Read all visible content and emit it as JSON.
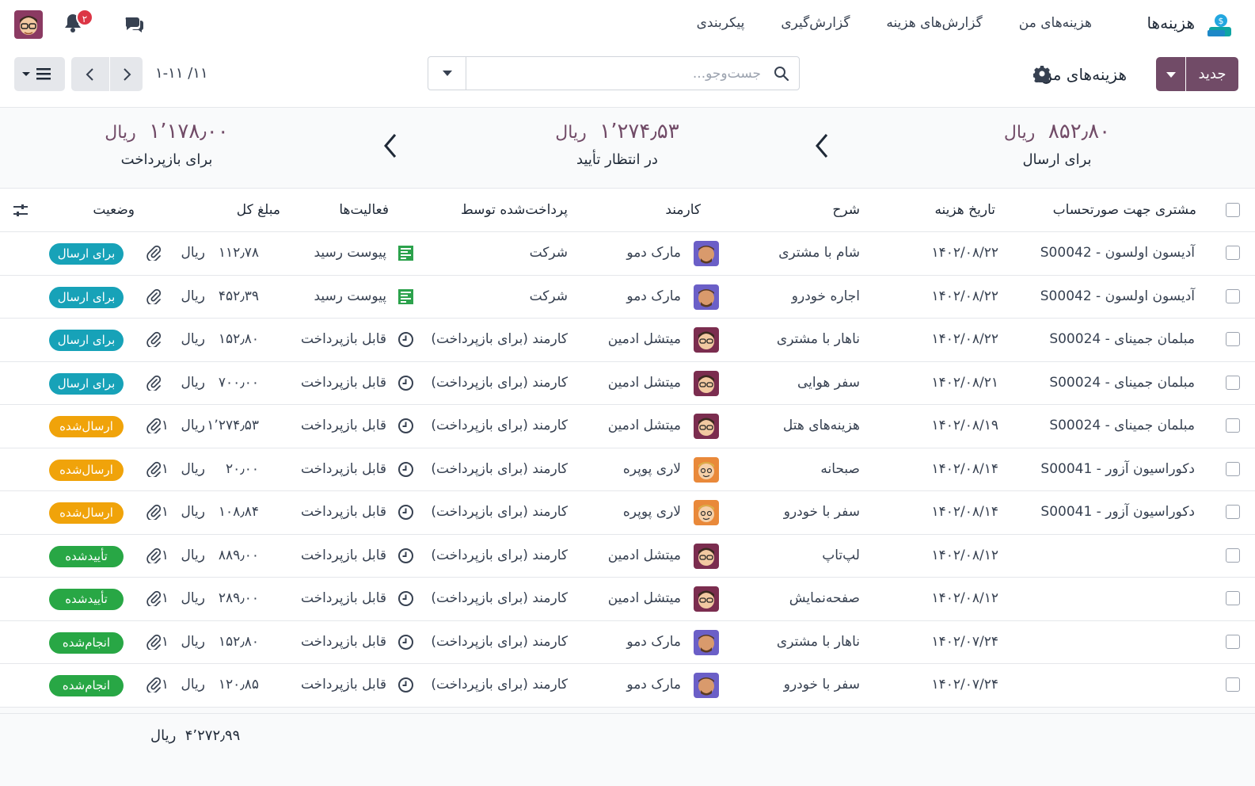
{
  "navbar": {
    "app_name": "هزینه‌ها",
    "menu": [
      "هزینه‌های من",
      "گزارش‌های هزینه",
      "گزارش‌گیری",
      "پیکربندی"
    ],
    "notification_count": "۲"
  },
  "control_panel": {
    "new_button": "جدید",
    "breadcrumb": "هزینه‌های من",
    "search_placeholder": "جست‌وجو...",
    "pager": "۱-۱۱ /۱۱"
  },
  "summary": {
    "currency": "ریال",
    "to_submit": {
      "amount": "۸۵۲٫۸۰",
      "label": "برای ارسال"
    },
    "pending": {
      "amount": "۱٬۲۷۴٫۵۳",
      "label": "در انتظار تأیید"
    },
    "to_reimburse": {
      "amount": "۱٬۱۷۸٫۰۰",
      "label": "برای بازپرداخت"
    }
  },
  "table": {
    "headers": {
      "customer": "مشتری جهت صورتحساب",
      "date": "تاریخ هزینه",
      "description": "شرح",
      "employee": "کارمند",
      "paid_by": "پرداخت‌شده توسط",
      "activities": "فعالیت‌ها",
      "total": "مبلغ کل",
      "status": "وضعیت"
    },
    "currency": "ریال",
    "rows": [
      {
        "customer": "آدیسون اولسون - S00042",
        "date": "۱۴۰۲/۰۸/۲۲",
        "description": "شام با مشتری",
        "employee": "مارک دمو",
        "avatar": "marc",
        "paid_by": "شرکت",
        "activity": "پیوست رسید",
        "activity_icon": "receipt-icon",
        "amount": "۱۱۲٫۷۸",
        "attachments": "",
        "status": "برای ارسال",
        "status_color": "#17a2b8"
      },
      {
        "customer": "آدیسون اولسون - S00042",
        "date": "۱۴۰۲/۰۸/۲۲",
        "description": "اجاره خودرو",
        "employee": "مارک دمو",
        "avatar": "marc",
        "paid_by": "شرکت",
        "activity": "پیوست رسید",
        "activity_icon": "receipt-icon",
        "amount": "۴۵۲٫۳۹",
        "attachments": "",
        "status": "برای ارسال",
        "status_color": "#17a2b8"
      },
      {
        "customer": "مبلمان جمینای - S00024",
        "date": "۱۴۰۲/۰۸/۲۲",
        "description": "ناهار با مشتری",
        "employee": "میتشل ادمین",
        "avatar": "mitchell",
        "paid_by": "کارمند (برای بازپرداخت)",
        "activity": "قابل بازپرداخت",
        "activity_icon": "clock-icon",
        "amount": "۱۵۲٫۸۰",
        "attachments": "",
        "status": "برای ارسال",
        "status_color": "#17a2b8"
      },
      {
        "customer": "مبلمان جمینای - S00024",
        "date": "۱۴۰۲/۰۸/۲۱",
        "description": "سفر هوایی",
        "employee": "میتشل ادمین",
        "avatar": "mitchell",
        "paid_by": "کارمند (برای بازپرداخت)",
        "activity": "قابل بازپرداخت",
        "activity_icon": "clock-icon",
        "amount": "۷۰۰٫۰۰",
        "attachments": "",
        "status": "برای ارسال",
        "status_color": "#17a2b8"
      },
      {
        "customer": "مبلمان جمینای - S00024",
        "date": "۱۴۰۲/۰۸/۱۹",
        "description": "هزینه‌های هتل",
        "employee": "میتشل ادمین",
        "avatar": "mitchell",
        "paid_by": "کارمند (برای بازپرداخت)",
        "activity": "قابل بازپرداخت",
        "activity_icon": "clock-icon",
        "amount": "۱٬۲۷۴٫۵۳",
        "attachments": "۱",
        "status": "ارسال‌شده",
        "status_color": "#f0a30a"
      },
      {
        "customer": "دکوراسیون آزور - S00041",
        "date": "۱۴۰۲/۰۸/۱۴",
        "description": "صبحانه",
        "employee": "لاری پوپره",
        "avatar": "larry",
        "paid_by": "کارمند (برای بازپرداخت)",
        "activity": "قابل بازپرداخت",
        "activity_icon": "clock-icon",
        "amount": "۲۰٫۰۰",
        "attachments": "۱",
        "status": "ارسال‌شده",
        "status_color": "#f0a30a"
      },
      {
        "customer": "دکوراسیون آزور - S00041",
        "date": "۱۴۰۲/۰۸/۱۴",
        "description": "سفر با خودرو",
        "employee": "لاری پوپره",
        "avatar": "larry",
        "paid_by": "کارمند (برای بازپرداخت)",
        "activity": "قابل بازپرداخت",
        "activity_icon": "clock-icon",
        "amount": "۱۰۸٫۸۴",
        "attachments": "۱",
        "status": "ارسال‌شده",
        "status_color": "#f0a30a"
      },
      {
        "customer": "",
        "date": "۱۴۰۲/۰۸/۱۲",
        "description": "لپ‌تاپ",
        "employee": "میتشل ادمین",
        "avatar": "mitchell",
        "paid_by": "کارمند (برای بازپرداخت)",
        "activity": "قابل بازپرداخت",
        "activity_icon": "clock-icon",
        "amount": "۸۸۹٫۰۰",
        "attachments": "۱",
        "status": "تأییدشده",
        "status_color": "#28a745"
      },
      {
        "customer": "",
        "date": "۱۴۰۲/۰۸/۱۲",
        "description": "صفحه‌نمایش",
        "employee": "میتشل ادمین",
        "avatar": "mitchell",
        "paid_by": "کارمند (برای بازپرداخت)",
        "activity": "قابل بازپرداخت",
        "activity_icon": "clock-icon",
        "amount": "۲۸۹٫۰۰",
        "attachments": "۱",
        "status": "تأییدشده",
        "status_color": "#28a745"
      },
      {
        "customer": "",
        "date": "۱۴۰۲/۰۷/۲۴",
        "description": "ناهار با مشتری",
        "employee": "مارک دمو",
        "avatar": "marc",
        "paid_by": "کارمند (برای بازپرداخت)",
        "activity": "قابل بازپرداخت",
        "activity_icon": "clock-icon",
        "amount": "۱۵۲٫۸۰",
        "attachments": "۱",
        "status": "انجام‌شده",
        "status_color": "#28a745"
      },
      {
        "customer": "",
        "date": "۱۴۰۲/۰۷/۲۴",
        "description": "سفر با خودرو",
        "employee": "مارک دمو",
        "avatar": "marc",
        "paid_by": "کارمند (برای بازپرداخت)",
        "activity": "قابل بازپرداخت",
        "activity_icon": "clock-icon",
        "amount": "۱۲۰٫۸۵",
        "attachments": "۱",
        "status": "انجام‌شده",
        "status_color": "#28a745"
      }
    ],
    "total": "۴٬۲۷۲٫۹۹"
  }
}
